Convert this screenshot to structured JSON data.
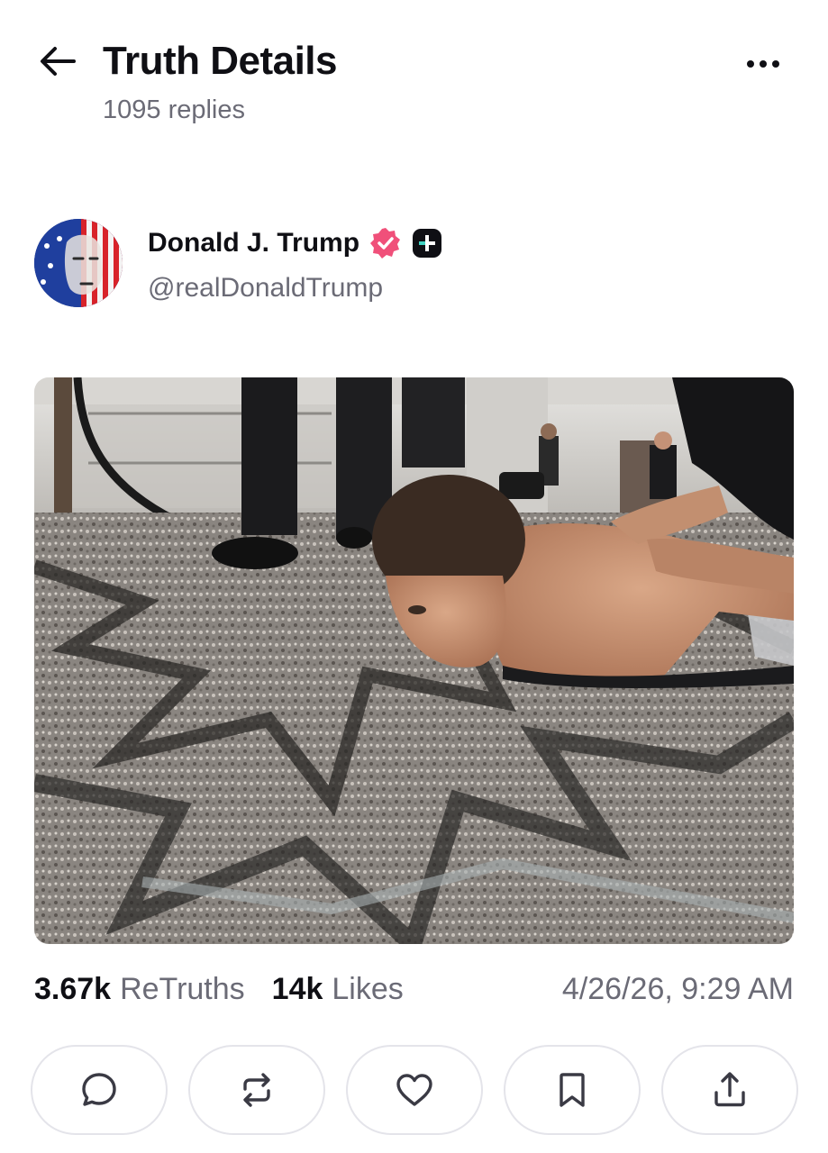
{
  "header": {
    "title": "Truth Details",
    "subtitle": "1095 replies",
    "back_icon": "arrow-left-icon",
    "more_icon": "ellipsis-icon"
  },
  "author": {
    "name": "Donald J. Trump",
    "handle": "@realDonaldTrump",
    "verified_color": "#f0507a",
    "badge_icon": "plus-badge-icon"
  },
  "post": {
    "media_description_icon": "photo",
    "stats": {
      "retruths_count": "3.67k",
      "retruths_label": "ReTruths",
      "likes_count": "14k",
      "likes_label": "Likes",
      "timestamp": "4/26/26, 9:29 AM"
    }
  },
  "actions": [
    {
      "icon": "reply-icon"
    },
    {
      "icon": "retruth-icon"
    },
    {
      "icon": "like-icon"
    },
    {
      "icon": "bookmark-icon"
    },
    {
      "icon": "share-icon"
    }
  ]
}
